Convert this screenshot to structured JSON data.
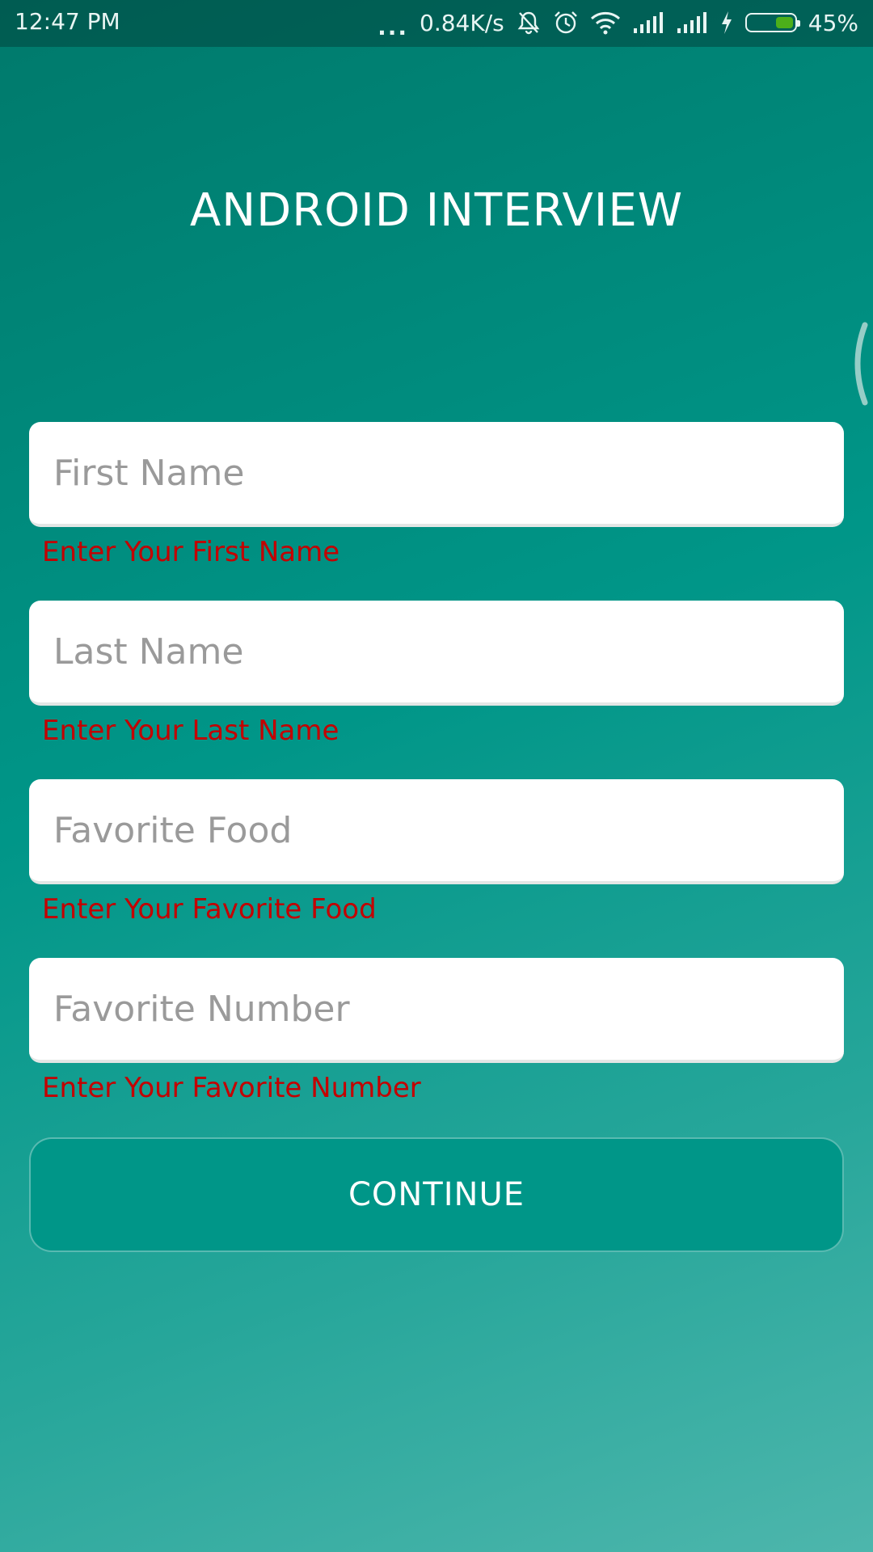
{
  "status_bar": {
    "time": "12:47 PM",
    "more": "...",
    "network_speed": "0.84K/s",
    "battery_percent": "45%",
    "battery_level": 0.45,
    "battery_color": "#4caf1a",
    "icons": [
      "muted-bell-icon",
      "alarm-icon",
      "wifi-icon",
      "signal-icon",
      "signal-icon",
      "charging-icon",
      "battery-icon"
    ]
  },
  "title": "ANDROID INTERVIEW",
  "form": {
    "fields": [
      {
        "placeholder": "First Name",
        "value": "",
        "error": "Enter Your First Name"
      },
      {
        "placeholder": "Last Name",
        "value": "",
        "error": "Enter Your Last Name"
      },
      {
        "placeholder": "Favorite Food",
        "value": "",
        "error": "Enter Your Favorite Food"
      },
      {
        "placeholder": "Favorite Number",
        "value": "",
        "error": "Enter Your Favorite Number"
      }
    ],
    "continue_label": "CONTINUE"
  },
  "colors": {
    "background_top": "#00796b",
    "background_bottom": "#4db6ac",
    "error_text": "#c40000",
    "button": "#009688"
  }
}
